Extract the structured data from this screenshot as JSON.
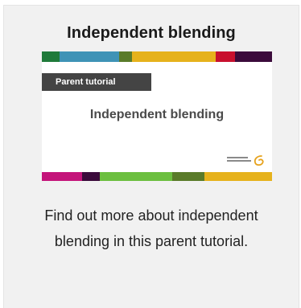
{
  "card": {
    "title": "Independent blending",
    "thumbnail": {
      "badge": "Parent tutorial",
      "heading": "Independent blending",
      "logo_icon": "brand-logo-icon",
      "stripe_colors_top": [
        "#1f7a3a",
        "#3f93b6",
        "#3f93b6",
        "#5a7b2a",
        "#e6b21c",
        "#e6b21c",
        "#c8102e",
        "#3b0b3b"
      ],
      "stripe_colors_bottom": [
        "#c4147a",
        "#3b0b3b",
        "#6cbf3f",
        "#6cbf3f",
        "#5a7b2a",
        "#e6b21c",
        "#e6b21c"
      ]
    },
    "description": "Find out more about independent blending in this parent tutorial."
  }
}
